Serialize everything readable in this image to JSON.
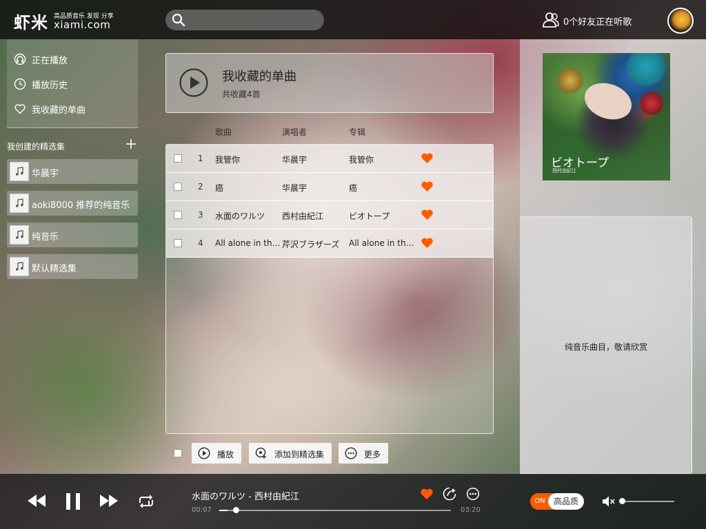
{
  "brand": {
    "logo_text": "虾米",
    "slogan": "高品质音乐 发现 分享",
    "domain": "xiami.com"
  },
  "search": {
    "placeholder": "",
    "value": ""
  },
  "friends": {
    "text": "0个好友正在听歌"
  },
  "nav": {
    "items": [
      {
        "label": "正在播放",
        "icon": "now-playing-icon"
      },
      {
        "label": "播放历史",
        "icon": "history-icon"
      },
      {
        "label": "我收藏的单曲",
        "icon": "heart-outline-icon"
      }
    ]
  },
  "collections": {
    "title": "我创建的精选集",
    "items": [
      {
        "label": "华晨宇"
      },
      {
        "label": "aoki8000 推荐的纯音乐"
      },
      {
        "label": "纯音乐"
      },
      {
        "label": "默认精选集"
      }
    ]
  },
  "header": {
    "title": "我收藏的单曲",
    "subtitle": "共收藏4首"
  },
  "columns": {
    "song": "歌曲",
    "artist": "演唱者",
    "album": "专辑"
  },
  "songs": [
    {
      "num": "1",
      "title": "我管你",
      "artist": "华晨宇",
      "album": "我管你",
      "favorited": true
    },
    {
      "num": "2",
      "title": "癌",
      "artist": "华晨宇",
      "album": "癌",
      "favorited": true
    },
    {
      "num": "3",
      "title": "水面のワルツ",
      "artist": "西村由紀江",
      "album": "ビオトープ",
      "favorited": true
    },
    {
      "num": "4",
      "title": "All alone in the...",
      "artist": "芹沢ブラザーズ",
      "album": "All alone in the...",
      "favorited": true
    }
  ],
  "actions": {
    "play": "播放",
    "add_to_collection": "添加到精选集",
    "more": "更多"
  },
  "album_cover": {
    "title": "ビオトープ",
    "artist": "西村由紀江"
  },
  "lyrics": {
    "text": "纯音乐曲目，敬请欣赏"
  },
  "player": {
    "track": "水面のワルツ - 西村由紀江",
    "elapsed": "00:07",
    "duration": "03:20",
    "progress": 0.036,
    "is_playing": true,
    "liked": true,
    "quality_on": "ON",
    "quality_label": "高品质",
    "muted": true,
    "volume": 0
  },
  "colors": {
    "accent": "#ff5a00",
    "heart": "#ff5a00",
    "topbar_bg": "#0a0a0c",
    "player_bg": "#141418"
  }
}
